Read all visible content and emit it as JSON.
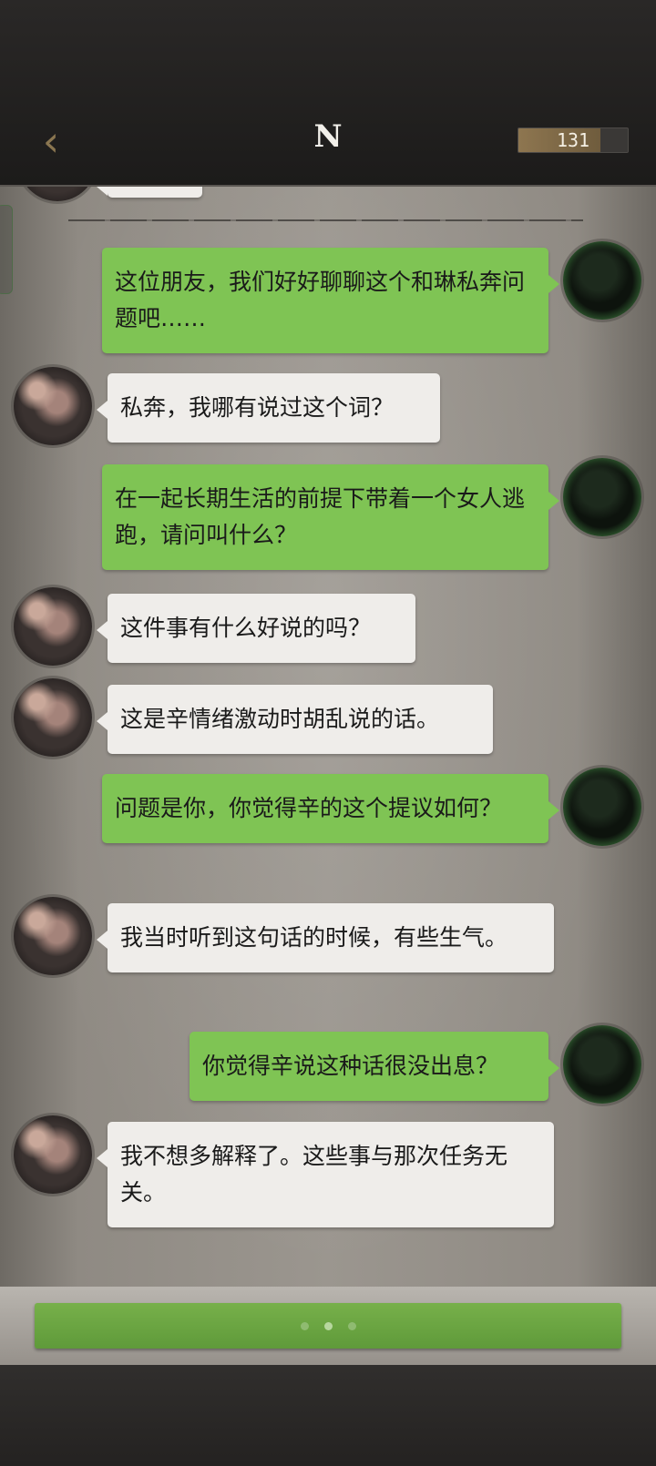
{
  "header": {
    "back_icon": "chevron-left-icon",
    "title": "N",
    "counter_value": "131",
    "counter_fill_fraction": 0.75
  },
  "messages": [
    {
      "side": "me",
      "text": "这位朋友，我们好好聊聊这个和琳私奔问题吧……"
    },
    {
      "side": "npc",
      "text": "私奔，我哪有说过这个词？"
    },
    {
      "side": "me",
      "text": "在一起长期生活的前提下带着一个女人逃跑，请问叫什么？"
    },
    {
      "side": "npc",
      "text": "这件事有什么好说的吗？"
    },
    {
      "side": "npc",
      "text": "这是辛情绪激动时胡乱说的话。"
    },
    {
      "side": "me",
      "text": "问题是你，你觉得辛的这个提议如何？"
    },
    {
      "side": "npc",
      "text": "我当时听到这句话的时候，有些生气。"
    },
    {
      "side": "me",
      "text": "你觉得辛说这种话很没出息？"
    },
    {
      "side": "npc",
      "text": "我不想多解释了。这些事与那次任务无关。"
    }
  ],
  "reply_bar": {
    "dots_total": 3,
    "active_dot_index": 1
  },
  "colors": {
    "player_bubble": "#7fc454",
    "npc_bubble": "#efedea",
    "accent_gold": "#8a7650"
  }
}
